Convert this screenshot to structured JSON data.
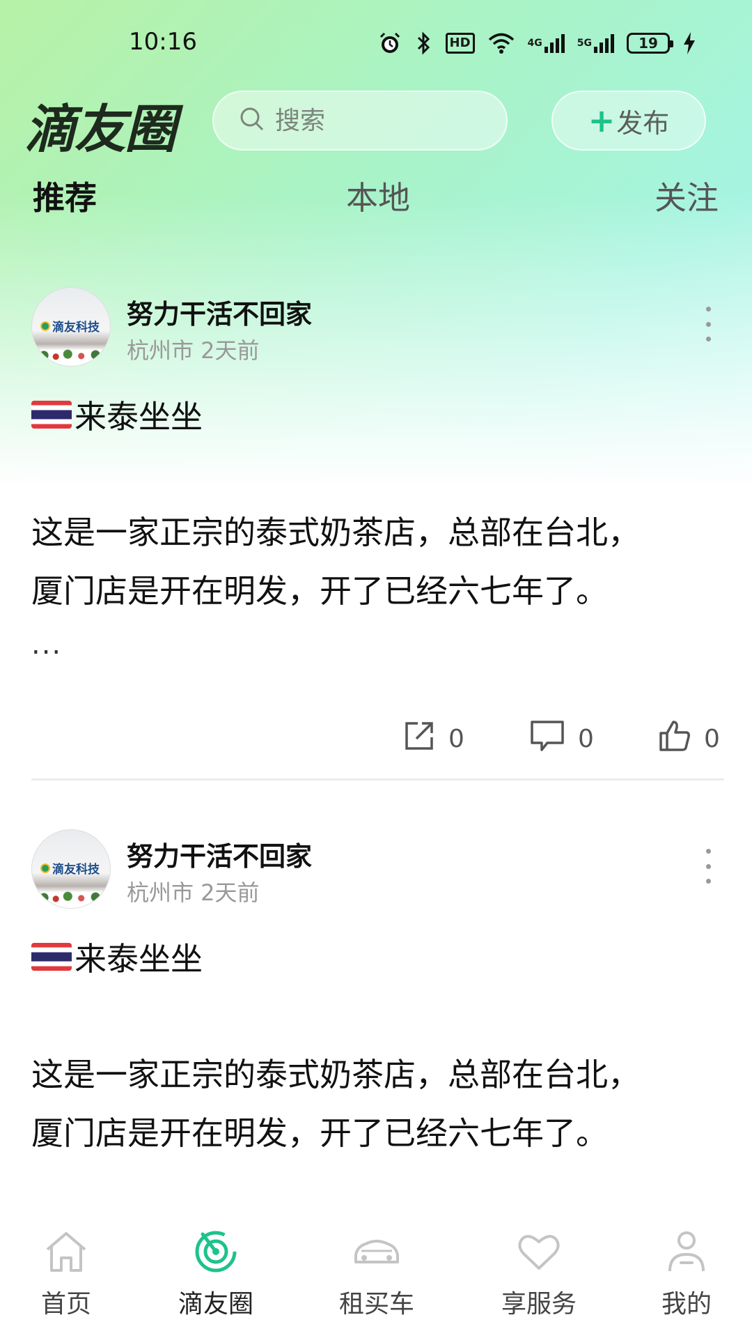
{
  "status_bar": {
    "time": "10:16",
    "hd_label": "HD",
    "net_4g": "4G",
    "net_5g": "5G",
    "battery": "19"
  },
  "header": {
    "title": "滴友圈",
    "search_placeholder": "搜索",
    "publish_plus": "+",
    "publish_label": "发布"
  },
  "tabs": [
    {
      "label": "推荐",
      "active": true
    },
    {
      "label": "本地",
      "active": false
    },
    {
      "label": "关注",
      "active": false
    }
  ],
  "posts": [
    {
      "avatar_logo_text": "滴友科技",
      "username": "努力干活不回家",
      "meta": "杭州市 2天前",
      "title": "来泰坐坐",
      "body_line1": "这是一家正宗的泰式奶茶店，总部在台北，",
      "body_line2": "厦门店是开在明发，开了已经六七年了。",
      "ellipsis": "...",
      "share_count": "0",
      "comment_count": "0",
      "like_count": "0"
    },
    {
      "avatar_logo_text": "滴友科技",
      "username": "努力干活不回家",
      "meta": "杭州市 2天前",
      "title": "来泰坐坐",
      "body_line1": "这是一家正宗的泰式奶茶店，总部在台北，",
      "body_line2": "厦门店是开在明发，开了已经六七年了。"
    }
  ],
  "bottom_nav": [
    {
      "label": "首页",
      "icon": "home-icon"
    },
    {
      "label": "滴友圈",
      "icon": "radar-icon",
      "active": true
    },
    {
      "label": "租买车",
      "icon": "car-icon"
    },
    {
      "label": "享服务",
      "icon": "heart-icon"
    },
    {
      "label": "我的",
      "icon": "user-icon"
    }
  ],
  "colors": {
    "accent": "#1ec28b",
    "gradient_start": "#b7f2a6",
    "gradient_end": "#a6f4e0"
  }
}
